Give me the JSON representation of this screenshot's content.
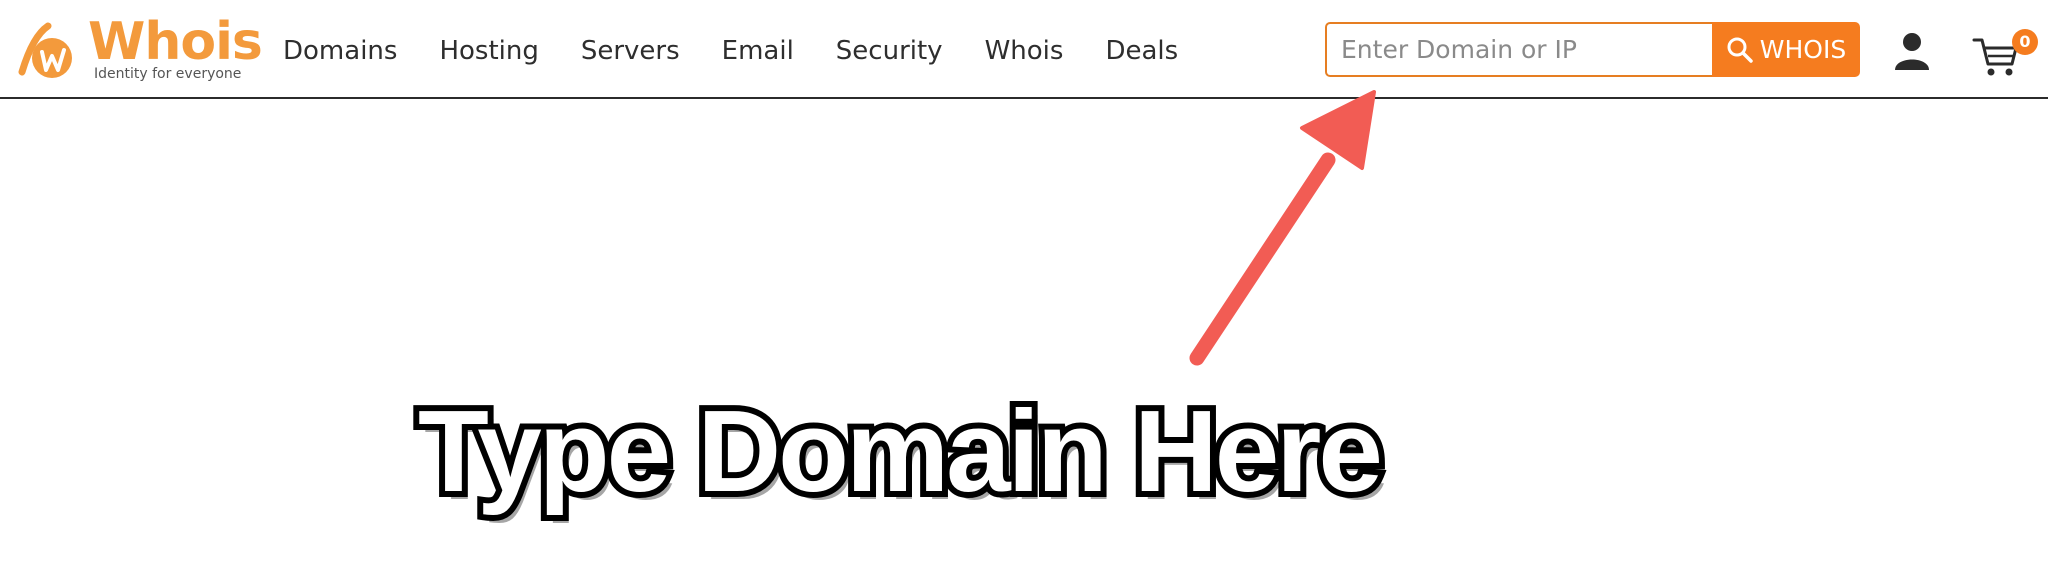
{
  "header": {
    "logo": {
      "wordmark": "Whois",
      "tagline": "Identity for everyone"
    },
    "nav": [
      {
        "label": "Domains"
      },
      {
        "label": "Hosting"
      },
      {
        "label": "Servers"
      },
      {
        "label": "Email"
      },
      {
        "label": "Security"
      },
      {
        "label": "Whois"
      },
      {
        "label": "Deals"
      }
    ],
    "search": {
      "placeholder": "Enter Domain or IP",
      "value": "",
      "button_label": "WHOIS",
      "button_icon": "search-icon"
    },
    "account_icon": "user-icon",
    "cart": {
      "icon": "cart-icon",
      "count": "0"
    }
  },
  "annotation": {
    "caption": "Type Domain Here",
    "arrow_color": "#f25c54"
  },
  "colors": {
    "brand_orange": "#f57c1f",
    "logo_orange": "#f39a3c",
    "nav_text": "#2e2e2e",
    "arrow": "#f25c54"
  }
}
